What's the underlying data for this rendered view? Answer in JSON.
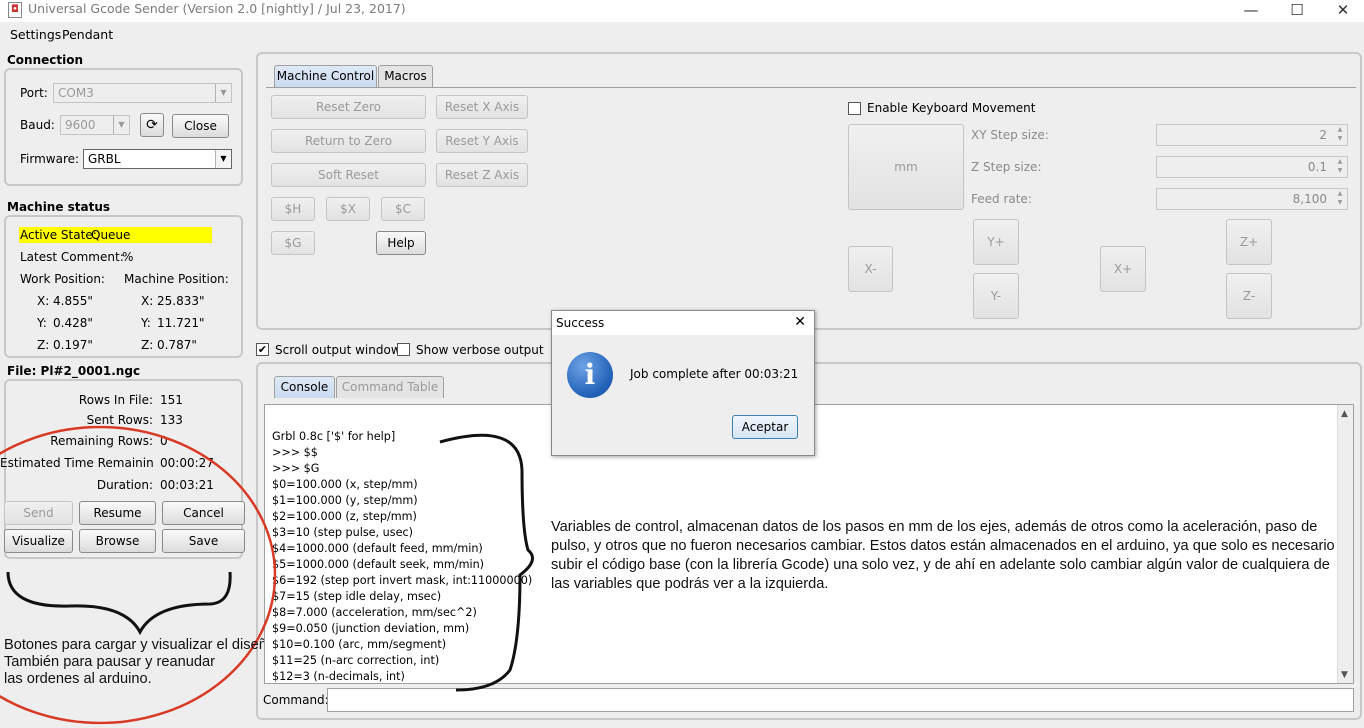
{
  "window": {
    "title": "Universal Gcode Sender (Version 2.0 [nightly]  / Jul 23, 2017)",
    "minimize_glyph": "—",
    "maximize_glyph": "☐",
    "close_glyph": "✕"
  },
  "menu": [
    "Settings",
    "Pendant"
  ],
  "connection": {
    "title": "Connection",
    "port_label": "Port:",
    "port_value": "COM3",
    "baud_label": "Baud:",
    "baud_value": "9600",
    "refresh_glyph": "⟳",
    "close_button": "Close",
    "firmware_label": "Firmware:",
    "firmware_value": "GRBL"
  },
  "machine_status": {
    "title": "Machine status",
    "active_state_label": "Active State:",
    "active_state_value": "Queue",
    "latest_comment_label": "Latest Comment:",
    "latest_comment_value": "%",
    "work_position_label": "Work Position:",
    "machine_position_label": "Machine Position:",
    "work": {
      "x_label": "X:",
      "x": "4.855\"",
      "y_label": "Y:",
      "y": "0.428\"",
      "z_label": "Z:",
      "z": "0.197\""
    },
    "machine": {
      "x_label": "X:",
      "x": "25.833\"",
      "y_label": "Y:",
      "y": "11.721\"",
      "z_label": "Z:",
      "z": "0.787\""
    }
  },
  "file": {
    "title": "File: Pl#2_0001.ngc",
    "rows_in_file_label": "Rows In File:",
    "rows_in_file": "151",
    "sent_rows_label": "Sent Rows:",
    "sent_rows": "133",
    "remaining_rows_label": "Remaining Rows:",
    "remaining_rows": "0",
    "estimated_label": "Estimated Time Remaining:",
    "estimated": "00:00:27",
    "duration_label": "Duration:",
    "duration": "00:03:21",
    "buttons": {
      "send": "Send",
      "resume": "Resume",
      "cancel": "Cancel",
      "visualize": "Visualize",
      "browse": "Browse",
      "save": "Save"
    }
  },
  "machine_control": {
    "tabs": [
      "Machine Control",
      "Macros"
    ],
    "reset_zero": "Reset Zero",
    "return_to_zero": "Return to Zero",
    "soft_reset": "Soft Reset",
    "reset_x": "Reset X Axis",
    "reset_y": "Reset Y Axis",
    "reset_z": "Reset Z Axis",
    "cmd_h": "$H",
    "cmd_x": "$X",
    "cmd_c": "$C",
    "cmd_g": "$G",
    "help": "Help",
    "enable_keyboard": "Enable Keyboard Movement",
    "units_button": "mm",
    "xy_step_label": "XY Step size:",
    "xy_step_value": "2",
    "z_step_label": "Z Step size:",
    "z_step_value": "0.1",
    "feed_rate_label": "Feed rate:",
    "feed_rate_value": "8,100",
    "jog": {
      "x_minus": "X-",
      "x_plus": "X+",
      "y_plus": "Y+",
      "y_minus": "Y-",
      "z_plus": "Z+",
      "z_minus": "Z-"
    }
  },
  "output_options": {
    "scroll_output": "Scroll output window",
    "scroll_output_checked": true,
    "show_verbose": "Show verbose output",
    "show_verbose_checked": false
  },
  "console_tabs": [
    "Console",
    "Command Table"
  ],
  "console_lines": [
    "Grbl 0.8c ['$' for help]",
    ">>> $$",
    ">>> $G",
    "$0=100.000 (x, step/mm)",
    "$1=100.000 (y, step/mm)",
    "$2=100.000 (z, step/mm)",
    "$3=10 (step pulse, usec)",
    "$4=1000.000 (default feed, mm/min)",
    "$5=1000.000 (default seek, mm/min)",
    "$6=192 (step port invert mask, int:11000000)",
    "$7=15 (step idle delay, msec)",
    "$8=7.000 (acceleration, mm/sec^2)",
    "$9=0.050 (junction deviation, mm)",
    "$10=0.100 (arc, mm/segment)",
    "$11=25 (n-arc correction, int)",
    "$12=3 (n-decimals, int)"
  ],
  "command_label": "Command:",
  "command_value": "",
  "dialog": {
    "title": "Success",
    "message": "Job complete after 00:03:21",
    "ok_button": "Aceptar",
    "close_glyph": "✕",
    "info_glyph": "i"
  },
  "annotations": {
    "right_note": "Variables de control, almacenan datos de los pasos en mm de los ejes, además de otros como la aceleración, paso de pulso, y otros que no fueron necesarios cambiar. Estos datos están almacenados en el arduino, ya que solo es necesario subir el código base (con la librería Gcode) una solo vez, y de ahí en adelante solo cambiar algún valor de cualquiera de las variables que podrás ver a la izquierda.",
    "left_note_lines": [
      "Botones para cargar y visualizar el diseño.",
      "También para pausar y reanudar",
      "las ordenes al arduino."
    ]
  },
  "colors": {
    "active_state_bg": "#ffff00",
    "annotation_circle": "#d93a26",
    "info_icon": "#1f5fb5"
  }
}
